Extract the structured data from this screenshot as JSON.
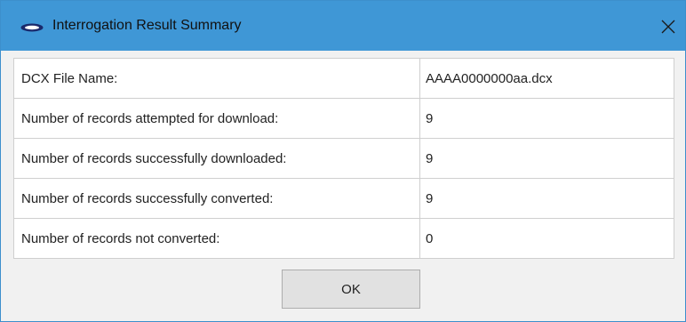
{
  "window": {
    "title": "Interrogation Result Summary",
    "icon": "app-window-icon",
    "close_icon": "close-icon"
  },
  "summary": {
    "rows": [
      {
        "label": "DCX File Name:",
        "value": "AAAA0000000aa.dcx"
      },
      {
        "label": "Number of records attempted for download:",
        "value": "9"
      },
      {
        "label": "Number of records successfully downloaded:",
        "value": "9"
      },
      {
        "label": "Number of records successfully converted:",
        "value": "9"
      },
      {
        "label": "Number of records not converted:",
        "value": "0"
      }
    ]
  },
  "buttons": {
    "ok_label": "OK"
  },
  "colors": {
    "titlebar": "#3f97d6",
    "dialog_background": "#f1f1f1",
    "button_face": "#e1e1e1"
  }
}
